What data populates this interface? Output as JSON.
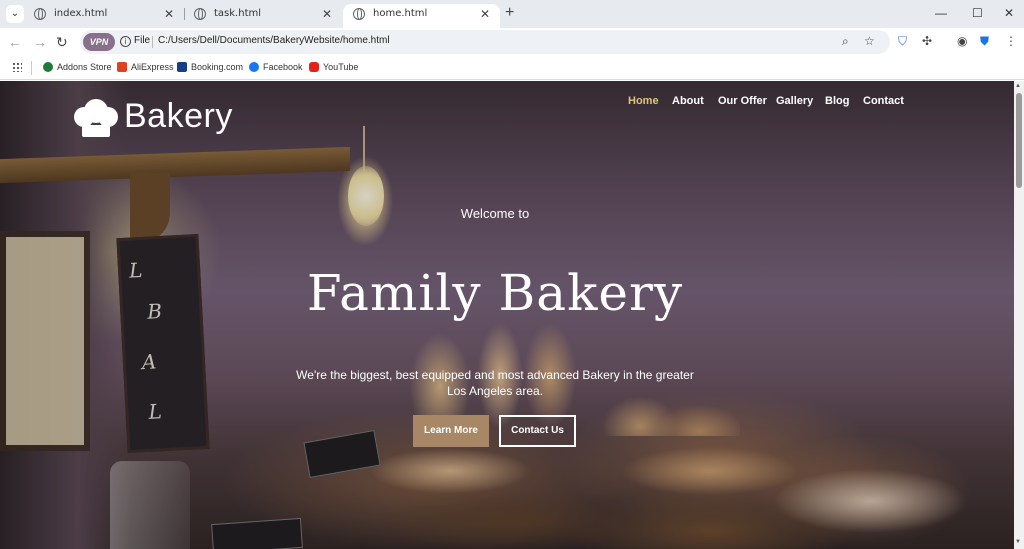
{
  "browser": {
    "tabs": [
      {
        "title": "index.html",
        "active": false
      },
      {
        "title": "task.html",
        "active": false
      },
      {
        "title": "home.html",
        "active": true
      }
    ],
    "tab_close": "✕",
    "new_tab": "+",
    "omnibox": {
      "vpn_label": "VPN",
      "scheme_label": "File",
      "url": "C:/Users/Dell/Documents/BakeryWebsite/home.html"
    },
    "bookmarks": [
      {
        "label": "Addons Store",
        "color": "#1f7a3a"
      },
      {
        "label": "AliExpress",
        "color": "#e2411f"
      },
      {
        "label": "Booking.com",
        "color": "#173f88"
      },
      {
        "label": "Facebook",
        "color": "#1877f2"
      },
      {
        "label": "YouTube",
        "color": "#e62117"
      }
    ],
    "window_controls": {
      "minimize": "—",
      "maximize": "☐",
      "close": "✕"
    }
  },
  "site": {
    "logo_text": "Bakery",
    "nav": [
      {
        "label": "Home",
        "active": true
      },
      {
        "label": "About",
        "active": false
      },
      {
        "label": "Our Offer",
        "active": false
      },
      {
        "label": "Gallery",
        "active": false
      },
      {
        "label": "Blog",
        "active": false
      },
      {
        "label": "Contact",
        "active": false
      }
    ],
    "hero": {
      "welcome": "Welcome to",
      "title": "Family Bakery",
      "tagline": "We're the biggest, best equipped and most advanced Bakery in the greater Los Angeles area.",
      "primary_button": "Learn More",
      "secondary_button": "Contact Us"
    },
    "accent_color": "#e0c37a",
    "button_color": "#a78766"
  }
}
